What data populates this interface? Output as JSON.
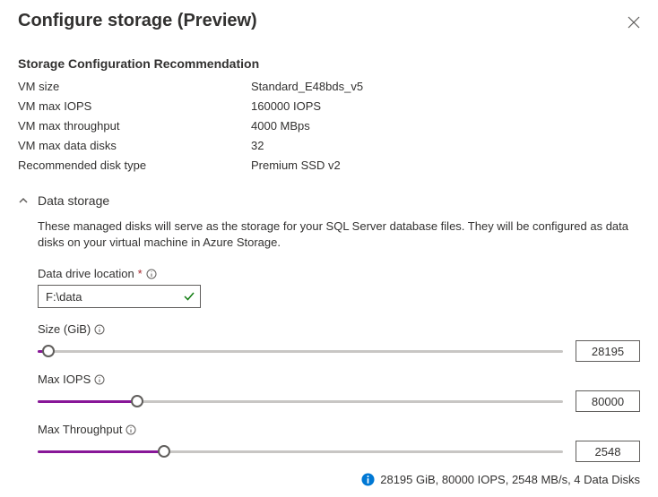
{
  "header": {
    "title": "Configure storage (Preview)"
  },
  "recommendation": {
    "heading": "Storage Configuration Recommendation",
    "rows": [
      {
        "label": "VM size",
        "value": "Standard_E48bds_v5"
      },
      {
        "label": "VM max IOPS",
        "value": "160000 IOPS"
      },
      {
        "label": "VM max throughput",
        "value": "4000 MBps"
      },
      {
        "label": "VM max data disks",
        "value": "32"
      },
      {
        "label": "Recommended disk type",
        "value": "Premium SSD v2"
      }
    ]
  },
  "dataStorage": {
    "title": "Data storage",
    "description": "These managed disks will serve as the storage for your SQL Server database files. They will be configured as data disks on your virtual machine in Azure Storage.",
    "driveLocation": {
      "label": "Data drive location",
      "value": "F:\\data"
    },
    "sliders": {
      "size": {
        "label": "Size (GiB)",
        "value": "28195",
        "percent": 2
      },
      "iops": {
        "label": "Max IOPS",
        "value": "80000",
        "percent": 19
      },
      "throughput": {
        "label": "Max Throughput",
        "value": "2548",
        "percent": 24
      }
    },
    "summary": "28195 GiB, 80000 IOPS, 2548 MB/s, 4 Data Disks"
  }
}
